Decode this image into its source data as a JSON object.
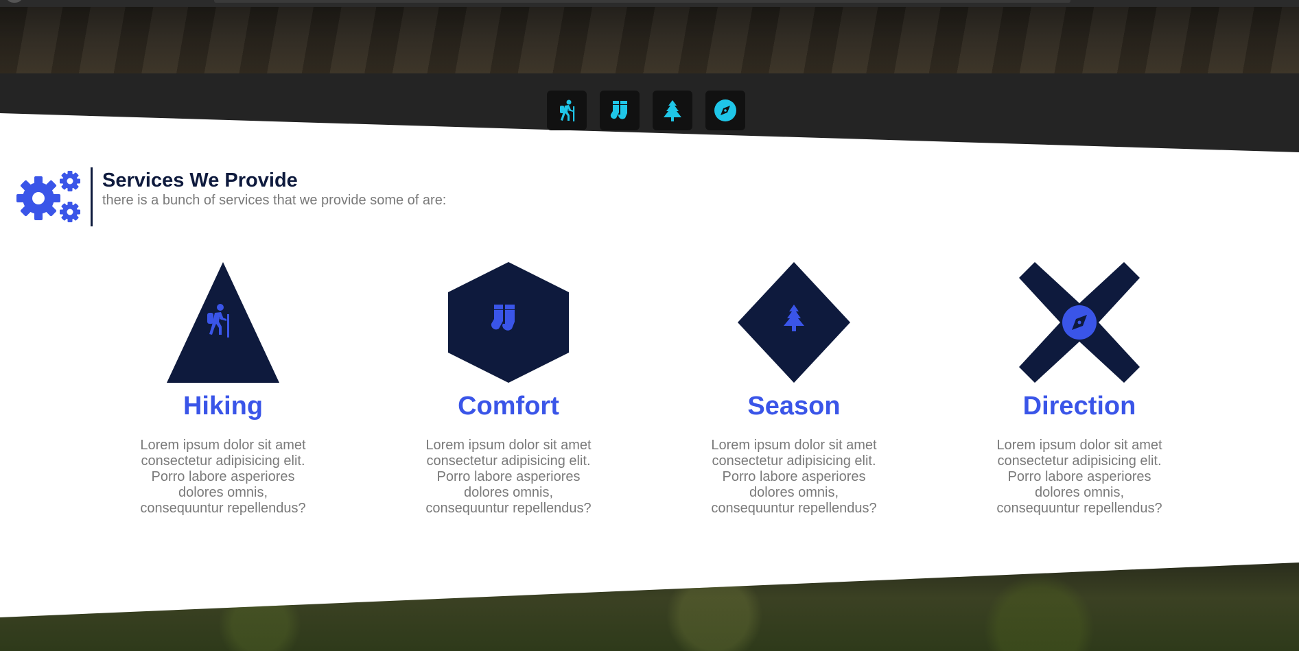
{
  "nav": {
    "icons": [
      "hiking-icon",
      "socks-icon",
      "tree-icon",
      "compass-icon"
    ]
  },
  "colors": {
    "accent_cyan": "#1fc6e8",
    "accent_blue": "#3a55e8",
    "navy": "#0e1a3d",
    "nav_band": "#242424"
  },
  "services": {
    "title": "Services We Provide",
    "subtitle": "there is a bunch of services that we provide some of are:",
    "icon": "gears-icon"
  },
  "cards": [
    {
      "title": "Hiking",
      "shape": "triangle",
      "icon": "hiking-icon",
      "text": "Lorem ipsum dolor sit amet consectetur adipisicing elit. Porro labore asperiores dolores omnis, consequuntur repellendus?"
    },
    {
      "title": "Comfort",
      "shape": "hexagon",
      "icon": "socks-icon",
      "text": "Lorem ipsum dolor sit amet consectetur adipisicing elit. Porro labore asperiores dolores omnis, consequuntur repellendus?"
    },
    {
      "title": "Season",
      "shape": "diamond",
      "icon": "tree-icon",
      "text": "Lorem ipsum dolor sit amet consectetur adipisicing elit. Porro labore asperiores dolores omnis, consequuntur repellendus?"
    },
    {
      "title": "Direction",
      "shape": "x-cross",
      "icon": "compass-icon",
      "text": "Lorem ipsum dolor sit amet consectetur adipisicing elit. Porro labore asperiores dolores omnis, consequuntur repellendus?"
    }
  ]
}
